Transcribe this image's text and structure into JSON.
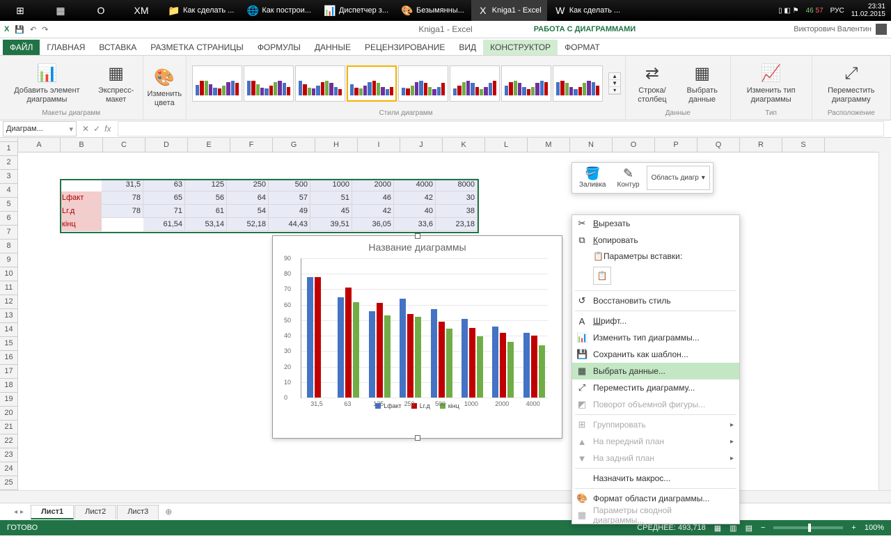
{
  "taskbar": {
    "items": [
      {
        "icon": "⊞",
        "label": ""
      },
      {
        "icon": "▦",
        "label": ""
      },
      {
        "icon": "O",
        "label": ""
      },
      {
        "icon": "XM",
        "label": ""
      },
      {
        "icon": "📁",
        "label": "Как сделать ..."
      },
      {
        "icon": "🌐",
        "label": "Как построи..."
      },
      {
        "icon": "📊",
        "label": "Диспетчер з..."
      },
      {
        "icon": "🎨",
        "label": "Безымянны..."
      },
      {
        "icon": "X",
        "label": "Kniga1 - Excel",
        "active": true
      },
      {
        "icon": "W",
        "label": "Как сделать ..."
      }
    ],
    "temp1": "46",
    "temp2": "57",
    "lang": "РУС",
    "time": "23:31",
    "date": "11.02.2015"
  },
  "window": {
    "title": "Kniga1 - Excel",
    "context_title": "РАБОТА С ДИАГРАММАМИ",
    "account": "Викторович Валентин"
  },
  "ribbon_tabs": [
    "ФАЙЛ",
    "ГЛАВНАЯ",
    "ВСТАВКА",
    "РАЗМЕТКА СТРАНИЦЫ",
    "ФОРМУЛЫ",
    "ДАННЫЕ",
    "РЕЦЕНЗИРОВАНИЕ",
    "ВИД",
    "КОНСТРУКТОР",
    "ФОРМАТ"
  ],
  "ribbon": {
    "add_element": "Добавить элемент диаграммы",
    "express": "Экспресс-макет",
    "colors": "Изменить цвета",
    "g_layouts": "Макеты диаграмм",
    "g_styles": "Стили диаграмм",
    "g_data": "Данные",
    "g_type": "Тип",
    "g_loc": "Расположение",
    "row_col": "Строка/столбец",
    "select_data": "Выбрать данные",
    "change_type": "Изменить тип диаграммы",
    "move": "Переместить диаграмму"
  },
  "namebox": "Диаграм...",
  "columns": [
    "A",
    "B",
    "C",
    "D",
    "E",
    "F",
    "G",
    "H",
    "I",
    "J",
    "K",
    "L",
    "M",
    "N",
    "O",
    "P",
    "Q",
    "R",
    "S"
  ],
  "rows": 25,
  "table": {
    "row3": [
      "",
      "",
      "31,5",
      "63",
      "125",
      "250",
      "500",
      "1000",
      "2000",
      "4000",
      "8000"
    ],
    "row4": [
      "",
      "Lфакт",
      "78",
      "65",
      "56",
      "64",
      "57",
      "51",
      "46",
      "42",
      "30"
    ],
    "row5": [
      "",
      "Lг.д",
      "78",
      "71",
      "61",
      "54",
      "49",
      "45",
      "42",
      "40",
      "38"
    ],
    "row6": [
      "",
      "кінц",
      "",
      "61,54",
      "53,14",
      "52,18",
      "44,43",
      "39,51",
      "36,05",
      "33,6",
      "23,18"
    ]
  },
  "chart_data": {
    "type": "bar",
    "title": "Название диаграммы",
    "categories": [
      "31,5",
      "63",
      "125",
      "250",
      "500",
      "1000",
      "2000",
      "4000"
    ],
    "series": [
      {
        "name": "Lфакт",
        "values": [
          78,
          65,
          56,
          64,
          57,
          51,
          46,
          42
        ],
        "color": "#4472c4"
      },
      {
        "name": "Lг.д",
        "values": [
          78,
          71,
          61,
          54,
          49,
          45,
          42,
          40
        ],
        "color": "#c00000"
      },
      {
        "name": "кінц",
        "values": [
          0,
          61.54,
          53.14,
          52.18,
          44.43,
          39.51,
          36.05,
          33.6
        ],
        "color": "#70ad47"
      }
    ],
    "ylim": [
      0,
      90
    ],
    "yticks": [
      0,
      10,
      20,
      30,
      40,
      50,
      60,
      70,
      80,
      90
    ]
  },
  "mini_toolbar": {
    "fill": "Заливка",
    "outline": "Контур",
    "area": "Область диагр"
  },
  "context_menu": {
    "cut": "Вырезать",
    "copy": "Копировать",
    "paste_header": "Параметры вставки:",
    "restore": "Восстановить стиль",
    "font": "Шрифт...",
    "change_type": "Изменить тип диаграммы...",
    "save_tmpl": "Сохранить как шаблон...",
    "select_data": "Выбрать данные...",
    "move": "Переместить диаграмму...",
    "rotate": "Поворот объемной фигуры...",
    "group": "Группировать",
    "front": "На передний план",
    "back": "На задний план",
    "macro": "Назначить макрос...",
    "format": "Формат области диаграммы...",
    "pivot": "Параметры сводной диаграммы..."
  },
  "sheets": [
    "Лист1",
    "Лист2",
    "Лист3"
  ],
  "status": {
    "ready": "ГОТОВО",
    "avg_label": "СРЕДНЕЕ:",
    "avg": "493,718",
    "zoom": "100%"
  }
}
